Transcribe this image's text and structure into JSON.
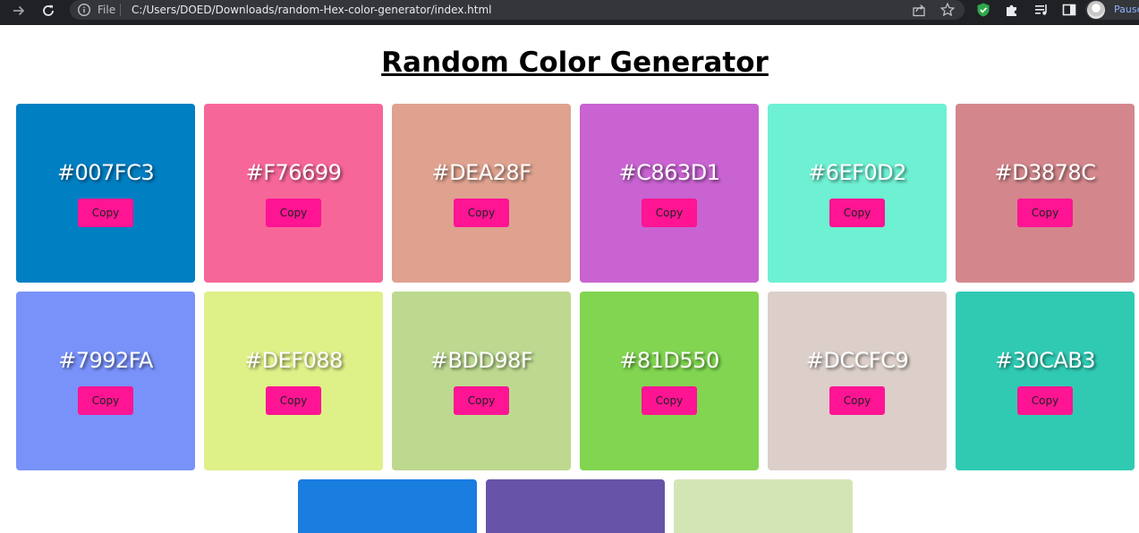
{
  "browser": {
    "file_label": "File",
    "url": "C:/Users/DOED/Downloads/random-Hex-color-generator/index.html",
    "profile_label": "Pause",
    "icons": {
      "forward": "arrow-right-icon",
      "reload": "reload-icon",
      "info": "info-icon",
      "share": "share-icon",
      "star": "star-icon",
      "shield": "shield-extension-icon",
      "puzzle": "extensions-icon",
      "media": "media-control-icon",
      "sidepanel": "side-panel-icon"
    }
  },
  "page": {
    "title": "Random Color Generator"
  },
  "cards": [
    {
      "hex": "#007FC3",
      "color": "#007FC3",
      "copy_label": "Copy"
    },
    {
      "hex": "#F76699",
      "color": "#F76699",
      "copy_label": "Copy"
    },
    {
      "hex": "#DEA28F",
      "color": "#DEA28F",
      "copy_label": "Copy"
    },
    {
      "hex": "#C863D1",
      "color": "#C863D1",
      "copy_label": "Copy"
    },
    {
      "hex": "#6EF0D2",
      "color": "#6EF0D2",
      "copy_label": "Copy"
    },
    {
      "hex": "#D3878C",
      "color": "#D3878C",
      "copy_label": "Copy"
    },
    {
      "hex": "#7992FA",
      "color": "#7992FA",
      "copy_label": "Copy"
    },
    {
      "hex": "#DEF088",
      "color": "#DEF088",
      "copy_label": "Copy"
    },
    {
      "hex": "#BDD98F",
      "color": "#BDD98F",
      "copy_label": "Copy"
    },
    {
      "hex": "#81D550",
      "color": "#81D550",
      "copy_label": "Copy"
    },
    {
      "hex": "#DCCFC9",
      "color": "#DCCFC9",
      "copy_label": "Copy"
    },
    {
      "hex": "#30CAB3",
      "color": "#30CAB3",
      "copy_label": "Copy"
    }
  ],
  "partial_cards": [
    {
      "color": "#1A7DE0"
    },
    {
      "color": "#6753A8"
    },
    {
      "color": "#D3E5B5"
    }
  ],
  "colors": {
    "copy_button": "#FF1493",
    "chrome_bg": "#202124",
    "omnibox_bg": "#35363A"
  }
}
